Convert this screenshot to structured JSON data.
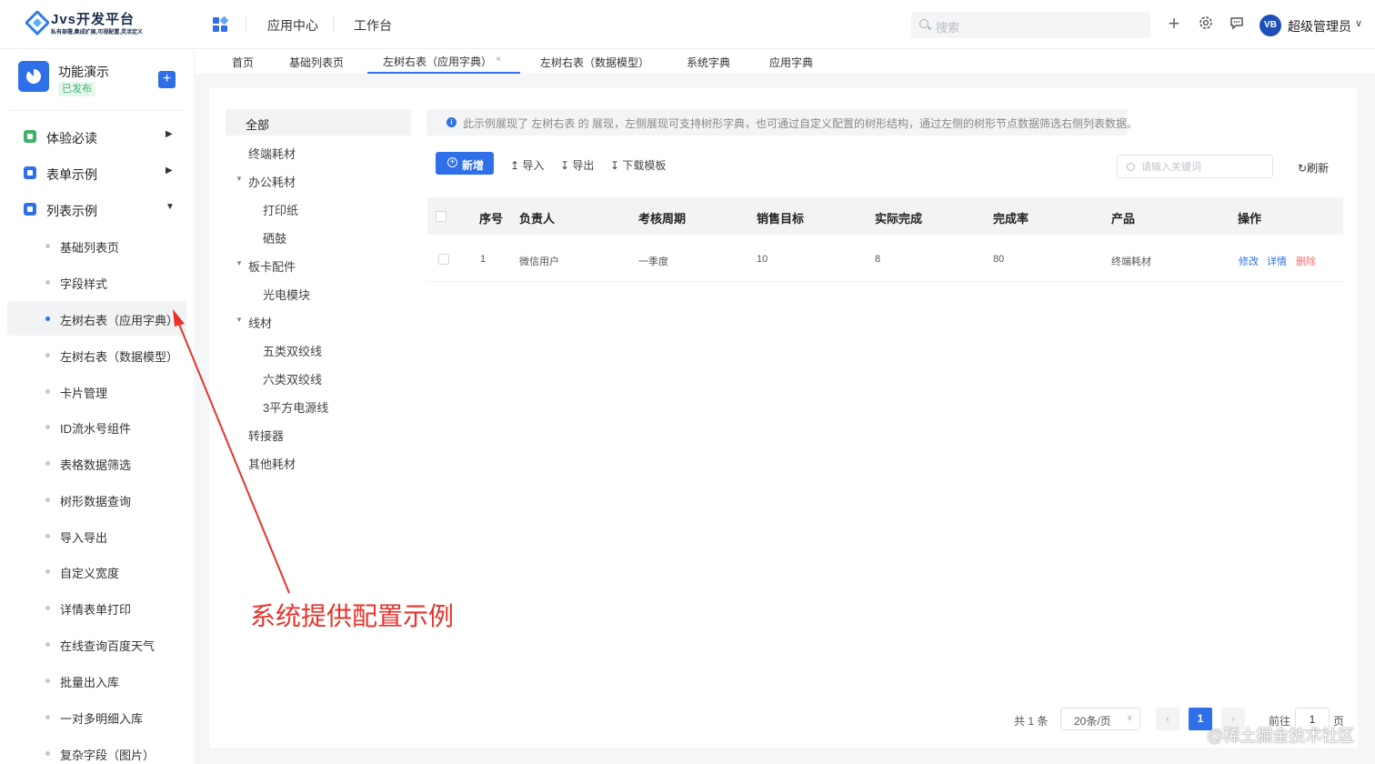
{
  "header": {
    "logo_title": "Jvs开发平台",
    "logo_subtitle": "私有部署,集成扩展,可视配置,灵活定义",
    "nav": [
      "应用中心",
      "工作台"
    ],
    "search_placeholder": "搜索",
    "user_avatar": "VB",
    "username": "超级管理员"
  },
  "tabs": [
    "首页",
    "基础列表页",
    "左树右表（应用字典）",
    "左树右表（数据模型）",
    "系统字典",
    "应用字典"
  ],
  "sidebar": {
    "app_name": "功能演示",
    "app_status": "已发布",
    "groups": [
      {
        "label": "体验必读",
        "color": "#3eb36a"
      },
      {
        "label": "表单示例",
        "color": "#2f6fe8"
      },
      {
        "label": "列表示例",
        "color": "#2f6fe8"
      }
    ],
    "items": [
      "基础列表页",
      "字段样式",
      "左树右表（应用字典）",
      "左树右表（数据模型）",
      "卡片管理",
      "ID流水号组件",
      "表格数据筛选",
      "树形数据查询",
      "导入导出",
      "自定义宽度",
      "详情表单打印",
      "在线查询百度天气",
      "批量出入库",
      "一对多明细入库",
      "复杂字段（图片）"
    ]
  },
  "tree": {
    "all": "全部",
    "nodes": [
      "终端耗材",
      "办公耗材",
      "打印纸",
      "硒鼓",
      "板卡配件",
      "光电模块",
      "线材",
      "五类双绞线",
      "六类双绞线",
      "3平方电源线",
      "转接器",
      "其他耗材"
    ]
  },
  "info_text": "此示例展现了 左树右表 的 展现，左侧展现可支持树形字典，也可通过自定义配置的树形结构，通过左侧的树形节点数据筛选右侧列表数据。",
  "toolbar": {
    "new": "新增",
    "import": "导入",
    "export": "导出",
    "download": "下载模板",
    "keyword_placeholder": "请输入关键词",
    "refresh": "刷新"
  },
  "table": {
    "columns": [
      "序号",
      "负责人",
      "考核周期",
      "销售目标",
      "实际完成",
      "完成率",
      "产品",
      "操作"
    ],
    "rows": [
      {
        "index": "1",
        "owner": "微信用户",
        "period": "一季度",
        "target": "10",
        "actual": "8",
        "rate": "80",
        "product": "终端耗材"
      }
    ],
    "actions": [
      "修改",
      "详情",
      "删除"
    ]
  },
  "pagination": {
    "total": "共 1 条",
    "page_size": "20条/页",
    "current": "1",
    "goto_label": "前往",
    "goto_value": "1",
    "page_suffix": "页"
  },
  "annotation": "系统提供配置示例",
  "credit": "@稀土掘金技术社区"
}
